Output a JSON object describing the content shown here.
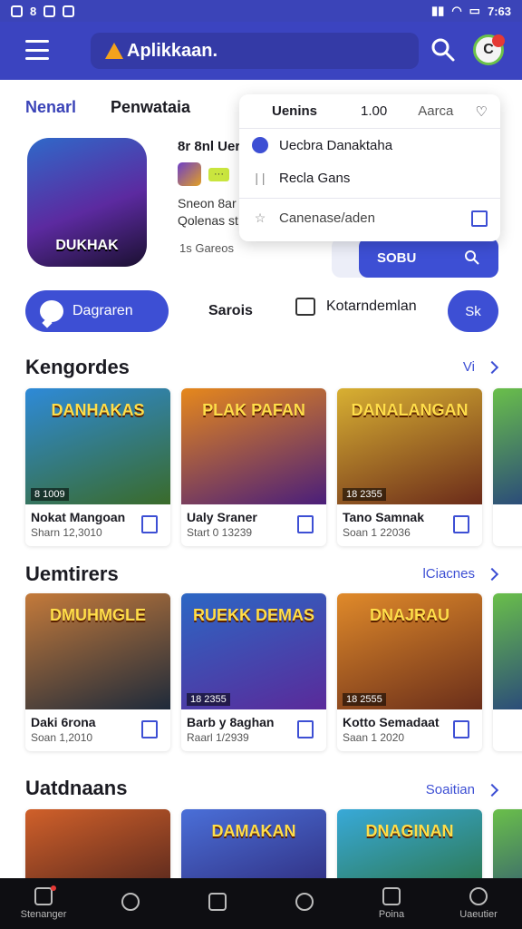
{
  "status_bar": {
    "left_text": "8",
    "right_text": "7:63"
  },
  "app_bar": {
    "brand_label": "Aplikkaan.",
    "search_icon": "search-icon",
    "avatar_letter": "C"
  },
  "tabs": [
    {
      "label": "Nenarl",
      "active": true
    },
    {
      "label": "Penwataia",
      "active": false
    }
  ],
  "featured": {
    "image_title": "DUKHAK",
    "name": "8r 8nl Uer",
    "badge_tag": "···",
    "meta_line1": "Sneon 8ar",
    "meta_line2": "Qolenas st",
    "small_text": "1s Gareos",
    "sort_label": "SOBU"
  },
  "popup": {
    "header": {
      "col1": "Uenins",
      "col2": "1.00",
      "col3": "Aarca"
    },
    "items": [
      {
        "label": "Uecbra Danaktaha"
      },
      {
        "label": "Recla Gans"
      },
      {
        "label": "Canenase/aden"
      }
    ]
  },
  "actions": {
    "primary_label": "Dagraren",
    "link_label": "Sarois",
    "note_label": "Kotarndemlan",
    "round_label": "Sk"
  },
  "sections": [
    {
      "title": "Kengordes",
      "more": "Vi",
      "cards": [
        {
          "img_title": "DANHAKAS",
          "tag": "8 1009",
          "name": "Nokat Mangoan",
          "sub": "Sharn 12,3010",
          "c1": "#2e8ad8",
          "c2": "#3a6b2a"
        },
        {
          "img_title": "PLAK PAFAN",
          "tag": "",
          "name": "Ualy Sraner",
          "sub": "Start 0 13239",
          "c1": "#e6881c",
          "c2": "#4a1e7a"
        },
        {
          "img_title": "DANALANGAN",
          "tag": "18 2355",
          "name": "Tano Samnak",
          "sub": "Soan 1 22036",
          "c1": "#d8b032",
          "c2": "#6b2b1a"
        }
      ]
    },
    {
      "title": "Uemtirers",
      "more": "lCiacnes",
      "cards": [
        {
          "img_title": "DMUHMGLE",
          "tag": "",
          "name": "Daki 6rona",
          "sub": "Soan 1,2010",
          "c1": "#c47a3a",
          "c2": "#1e2a3a"
        },
        {
          "img_title": "RUEKK DEMAS",
          "tag": "18 2355",
          "name": "Barb y 8aghan",
          "sub": "Raarl 1/2939",
          "c1": "#2c67c4",
          "c2": "#5a2a9a"
        },
        {
          "img_title": "DNAJRAU",
          "tag": "18 2555",
          "name": "Kotto Semadaat",
          "sub": "Saan 1 2020",
          "c1": "#e08a2a",
          "c2": "#6a2e1a"
        }
      ]
    },
    {
      "title": "Uatdnaans",
      "more": "Soaitian",
      "cards": [
        {
          "img_title": "",
          "tag": "",
          "name": "",
          "sub": "",
          "c1": "#d0602a",
          "c2": "#3a1a1a"
        },
        {
          "img_title": "DAMAKAN",
          "tag": "",
          "name": "",
          "sub": "",
          "c1": "#4a6fd8",
          "c2": "#2a1e6a"
        },
        {
          "img_title": "DNAGINAN",
          "tag": "",
          "name": "",
          "sub": "",
          "c1": "#38a9d8",
          "c2": "#2a6a2a"
        }
      ]
    }
  ],
  "bottom_nav": [
    {
      "label": "Stenanger",
      "icon": "home-icon"
    },
    {
      "label": "",
      "icon": "search-icon"
    },
    {
      "label": "",
      "icon": "store-icon"
    },
    {
      "label": "",
      "icon": "games-icon"
    },
    {
      "label": "Poina",
      "icon": "window-icon"
    },
    {
      "label": "Uaeutier",
      "icon": "profile-icon"
    }
  ]
}
